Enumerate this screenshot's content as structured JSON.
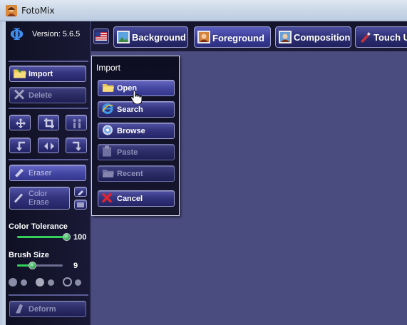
{
  "window": {
    "title": "FotoMix"
  },
  "sidebar": {
    "version_label": "Version: 5.6.5",
    "import_label": "Import",
    "delete_label": "Delete",
    "eraser_label": "Eraser",
    "color_erase_line1": "Color",
    "color_erase_line2": "Erase",
    "deform_label": "Deform",
    "color_tolerance": {
      "label": "Color Tolerance",
      "value": "100",
      "fraction": 1.0
    },
    "brush_size": {
      "label": "Brush Size",
      "value": "9",
      "fraction": 0.35
    }
  },
  "tabs": [
    {
      "label": "Background",
      "icon": "landscape-photo-icon",
      "active": false
    },
    {
      "label": "Foreground",
      "icon": "portrait-photo-icon",
      "active": true
    },
    {
      "label": "Composition",
      "icon": "composition-photo-icon",
      "active": false
    },
    {
      "label": "Touch Up",
      "icon": "brush-icon",
      "active": false
    }
  ],
  "import_menu": {
    "title": "Import",
    "items": [
      {
        "label": "Open",
        "icon": "folder-icon",
        "enabled": true
      },
      {
        "label": "Search",
        "icon": "internet-explorer-icon",
        "enabled": true
      },
      {
        "label": "Browse",
        "icon": "disc-icon",
        "enabled": true
      },
      {
        "label": "Paste",
        "icon": "clipboard-icon",
        "enabled": false
      },
      {
        "label": "Recent",
        "icon": "folder-stack-icon",
        "enabled": false
      }
    ],
    "cancel_label": "Cancel"
  },
  "colors": {
    "canvas": "#4a4c80",
    "panel": "#14142c",
    "accent_green": "#33d05a"
  }
}
